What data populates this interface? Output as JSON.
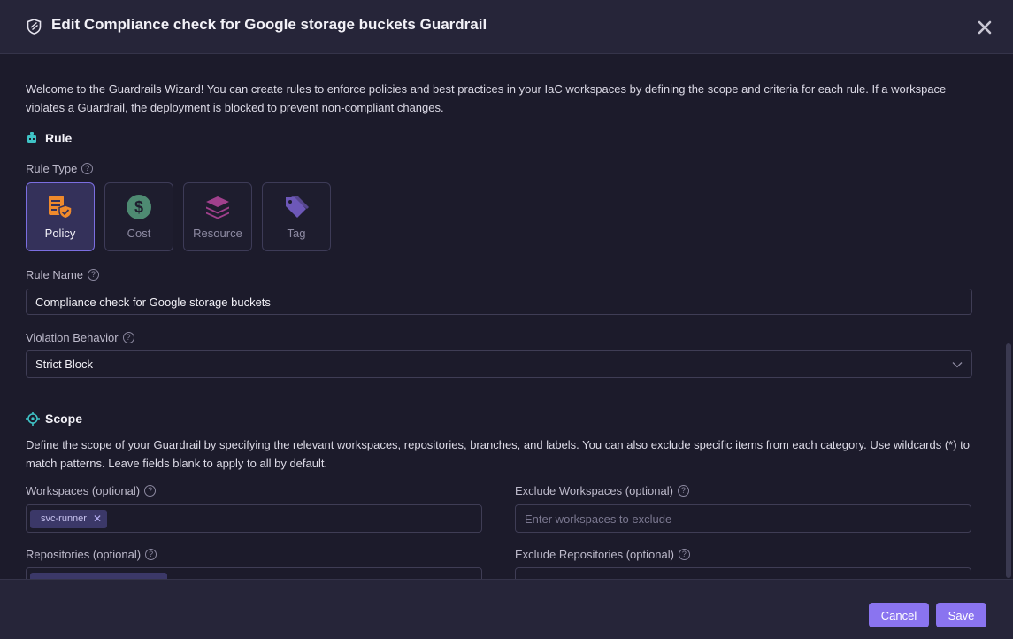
{
  "header": {
    "title": "Edit Compliance check for Google storage buckets Guardrail",
    "icon": "shield-icon",
    "close_icon": "close-icon"
  },
  "intro": "Welcome to the Guardrails Wizard! You can create rules to enforce policies and best practices in your IaC workspaces by defining the scope and criteria for each rule. If a workspace violates a Guardrail, the deployment is blocked to prevent non-compliant changes.",
  "rule": {
    "section_title": "Rule",
    "rule_type_label": "Rule Type",
    "rule_types": [
      {
        "label": "Policy",
        "icon": "policy-icon",
        "selected": true,
        "color": "#f08a2c"
      },
      {
        "label": "Cost",
        "icon": "dollar-icon",
        "selected": false,
        "color": "#4e8a72"
      },
      {
        "label": "Resource",
        "icon": "layers-icon",
        "selected": false,
        "color": "#a0408c"
      },
      {
        "label": "Tag",
        "icon": "tag-icon",
        "selected": false,
        "color": "#6d58b8"
      }
    ],
    "rule_name_label": "Rule Name",
    "rule_name_value": "Compliance check for Google storage buckets",
    "violation_label": "Violation Behavior",
    "violation_value": "Strict Block"
  },
  "scope": {
    "section_title": "Scope",
    "description": "Define the scope of your Guardrail by specifying the relevant workspaces, repositories, branches, and labels. You can also exclude specific items from each category. Use wildcards (*) to match patterns. Leave fields blank to apply to all by default.",
    "workspaces_label": "Workspaces (optional)",
    "workspaces_chips": [
      "svc-runner"
    ],
    "exclude_workspaces_label": "Exclude Workspaces (optional)",
    "exclude_workspaces_placeholder": "Enter workspaces to exclude",
    "repositories_label": "Repositories (optional)",
    "exclude_repositories_label": "Exclude Repositories (optional)"
  },
  "footer": {
    "cancel_label": "Cancel",
    "save_label": "Save"
  },
  "colors": {
    "accent": "#8a74f0",
    "background": "#1c1b2b",
    "header": "#262539"
  }
}
